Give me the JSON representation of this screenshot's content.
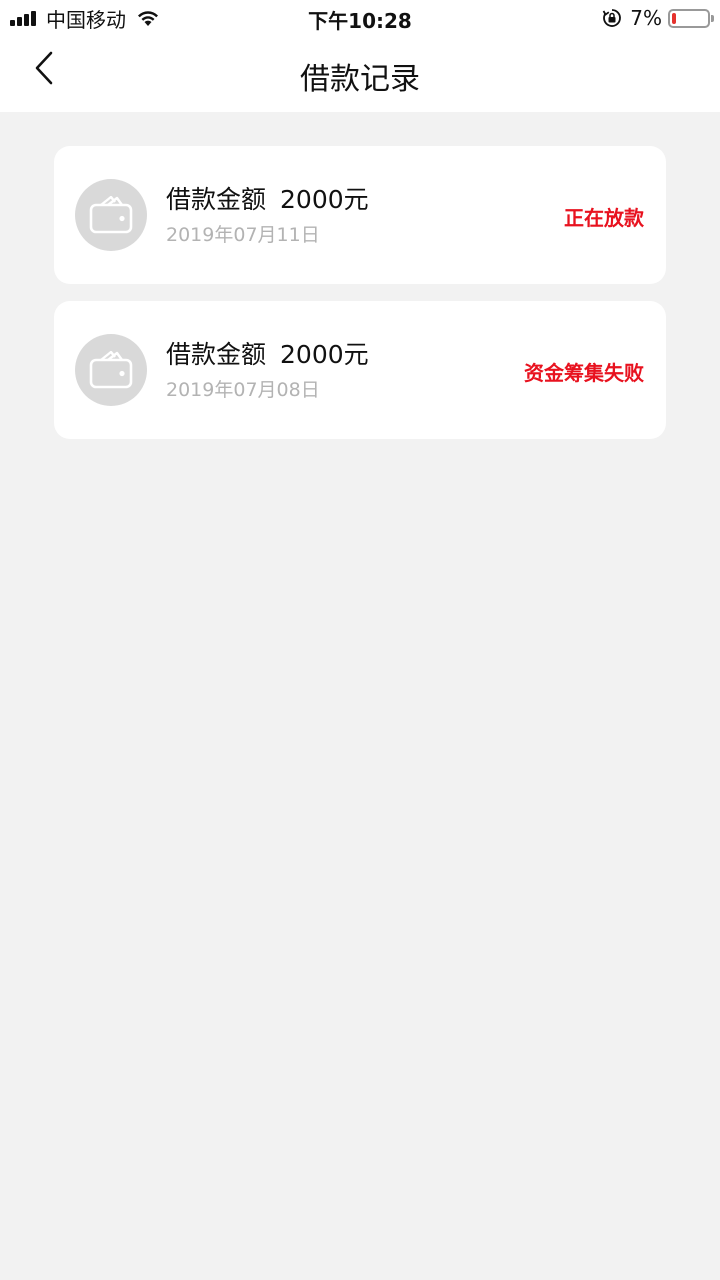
{
  "status_bar": {
    "carrier": "中国移动",
    "time": "下午10:28",
    "battery_percent_text": "7%",
    "battery_level": 0.07,
    "battery_color": "#e5322d"
  },
  "nav": {
    "title": "借款记录",
    "back_icon": "chevron-left-icon"
  },
  "records": [
    {
      "label": "借款金额",
      "amount": "2000元",
      "date": "2019年07月11日",
      "status": "正在放款",
      "icon": "wallet-icon"
    },
    {
      "label": "借款金额",
      "amount": "2000元",
      "date": "2019年07月08日",
      "status": "资金筹集失败",
      "icon": "wallet-icon"
    }
  ],
  "colors": {
    "status_text": "#e8121f",
    "date_text": "#b3b3b3",
    "page_bg": "#f2f2f2",
    "icon_circle": "#d9d9d9"
  }
}
